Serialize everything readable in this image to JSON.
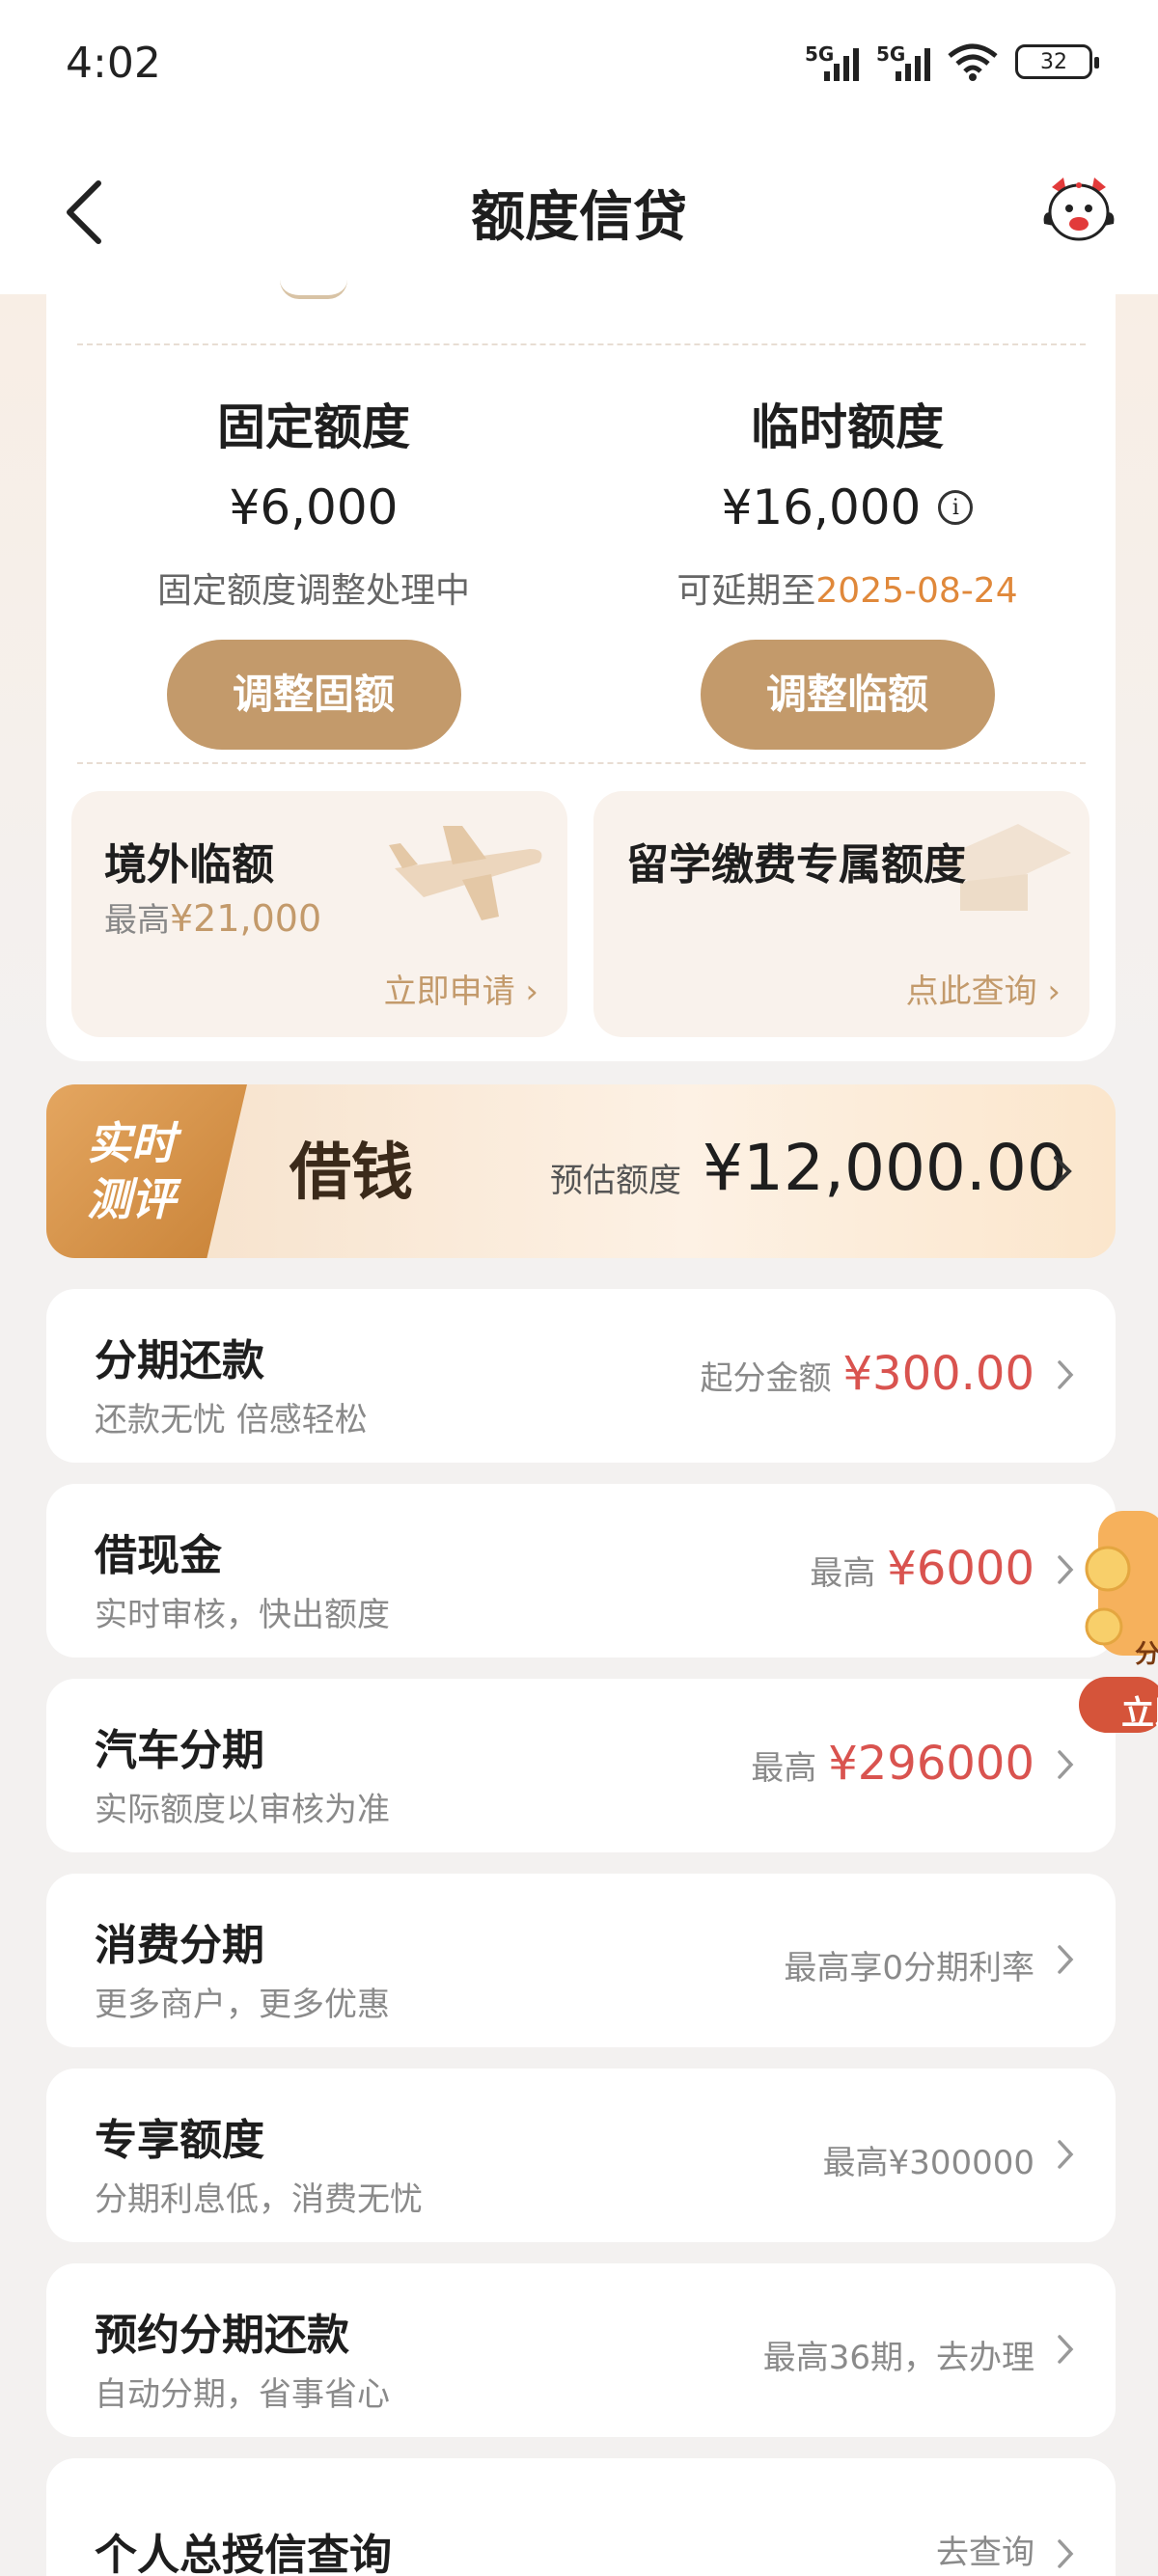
{
  "status": {
    "time": "4:02",
    "sig1": "5G",
    "sig2": "5G",
    "battery": "32"
  },
  "header": {
    "title": "额度信贷"
  },
  "quota": {
    "fixed": {
      "title": "固定额度",
      "amount": "¥6,000",
      "note": "固定额度调整处理中",
      "button": "调整固额"
    },
    "temp": {
      "title": "临时额度",
      "amount": "¥16,000",
      "note_prefix": "可延期至",
      "note_date": "2025-08-24",
      "button": "调整临额"
    },
    "overseas": {
      "title": "境外临额",
      "sub_prefix": "最高",
      "sub_amount": "¥21,000",
      "link": "立即申请"
    },
    "study": {
      "title": "留学缴费专属额度",
      "link": "点此查询"
    }
  },
  "borrow": {
    "badge_line1": "实时",
    "badge_line2": "测评",
    "title": "借钱",
    "est_label": "预估额度",
    "est_amount": "¥12,000.00"
  },
  "items": [
    {
      "title": "分期还款",
      "sub": "还款无忧 倍感轻松",
      "label": "起分金额",
      "value": "¥300.00"
    },
    {
      "title": "借现金",
      "sub": "实时审核，快出额度",
      "label": "最高",
      "value": "¥6000"
    },
    {
      "title": "汽车分期",
      "sub": "实际额度以审核为准",
      "label": "最高",
      "value": "¥296000"
    },
    {
      "title": "消费分期",
      "sub": "更多商户，更多优惠",
      "label": "最高享0分期利率",
      "value": ""
    },
    {
      "title": "专享额度",
      "sub": "分期利息低，消费无忧",
      "label": "最高¥300000",
      "value": ""
    },
    {
      "title": "预约分期还款",
      "sub": "自动分期，省事省心",
      "label": "最高36期，去办理",
      "value": ""
    },
    {
      "title": "个人总授信查询",
      "sub": "",
      "label": "去查询",
      "value": ""
    }
  ],
  "promo": {
    "line1": "分",
    "line2": "立即"
  },
  "colors": {
    "gold": "#c39a6b",
    "red": "#d9534f",
    "orange": "#e0883a"
  }
}
